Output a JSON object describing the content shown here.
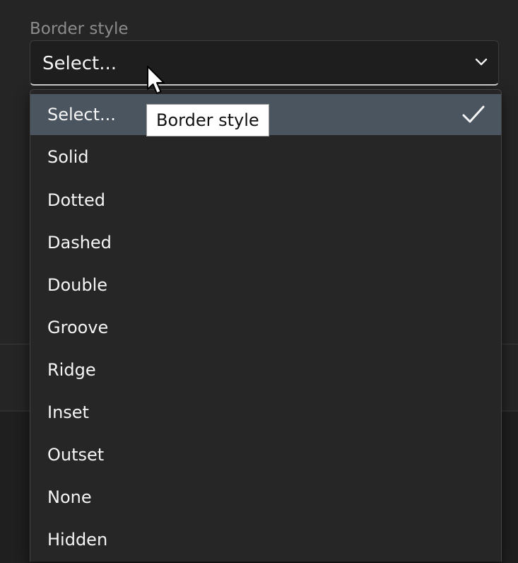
{
  "field": {
    "label": "Border style",
    "value": "Select..."
  },
  "dropdown": {
    "options": [
      {
        "label": "Select...",
        "selected": true
      },
      {
        "label": "Solid"
      },
      {
        "label": "Dotted"
      },
      {
        "label": "Dashed"
      },
      {
        "label": "Double"
      },
      {
        "label": "Groove"
      },
      {
        "label": "Ridge"
      },
      {
        "label": "Inset"
      },
      {
        "label": "Outset"
      },
      {
        "label": "None"
      },
      {
        "label": "Hidden"
      }
    ]
  },
  "tooltip": {
    "text": "Border style"
  },
  "icons": {
    "dropdown_arrow": "chevron-down-icon",
    "selected_mark": "checkmark-icon",
    "pointer": "mouse-pointer-icon"
  },
  "colors": {
    "background": "#252525",
    "selected_option": "#4b5560",
    "text": "#f5f5f5",
    "label": "#8c8c8c",
    "tooltip_bg": "#ffffff"
  }
}
